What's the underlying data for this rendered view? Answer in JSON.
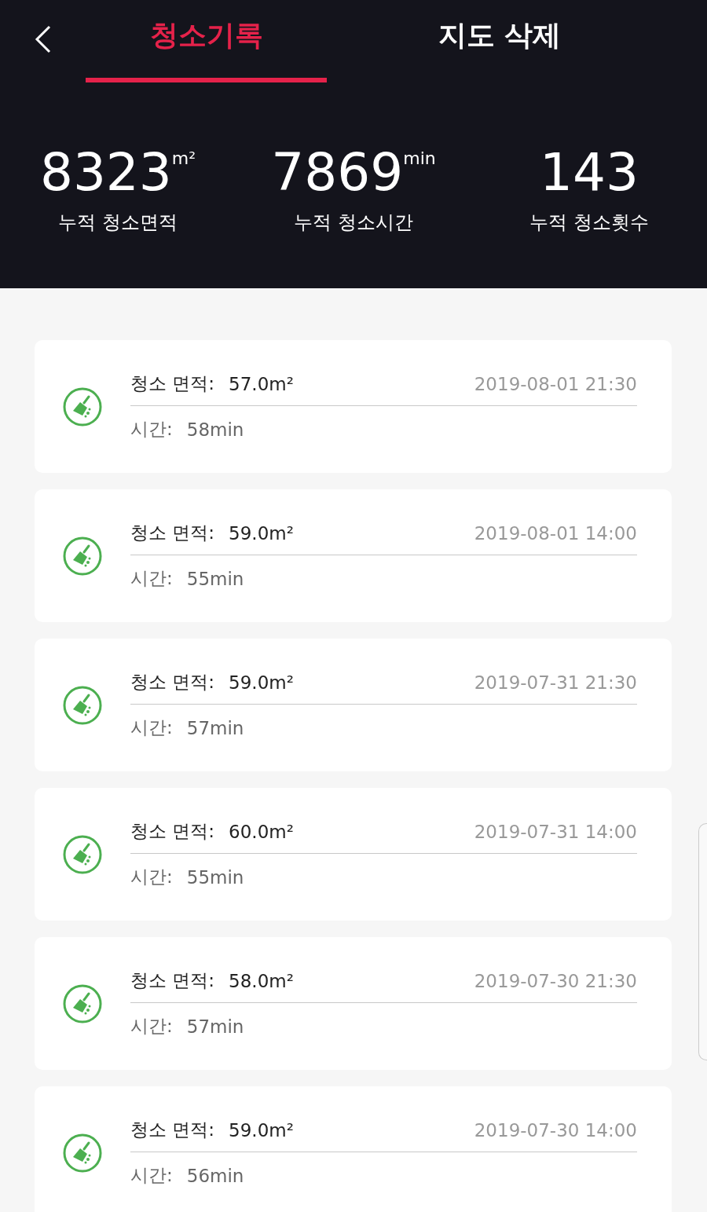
{
  "header": {
    "tabs": [
      {
        "label": "청소기록",
        "selected": true
      },
      {
        "label": "지도 삭제",
        "selected": false
      }
    ]
  },
  "stats": [
    {
      "value": "8323",
      "unit": "m²",
      "label": "누적 청소면적"
    },
    {
      "value": "7869",
      "unit": "min",
      "label": "누적 청소시간"
    },
    {
      "value": "143",
      "label": "누적 청소횟수"
    }
  ],
  "records": [
    {
      "area_label": "청소 면적:",
      "area": "57.0m²",
      "datetime": "2019-08-01 21:30",
      "time_label": "시간:",
      "time": "58min"
    },
    {
      "area_label": "청소 면적:",
      "area": "59.0m²",
      "datetime": "2019-08-01 14:00",
      "time_label": "시간:",
      "time": "55min"
    },
    {
      "area_label": "청소 면적:",
      "area": "59.0m²",
      "datetime": "2019-07-31 21:30",
      "time_label": "시간:",
      "time": "57min"
    },
    {
      "area_label": "청소 면적:",
      "area": "60.0m²",
      "datetime": "2019-07-31 14:00",
      "time_label": "시간:",
      "time": "55min"
    },
    {
      "area_label": "청소 면적:",
      "area": "58.0m²",
      "datetime": "2019-07-30 21:30",
      "time_label": "시간:",
      "time": "57min"
    },
    {
      "area_label": "청소 면적:",
      "area": "59.0m²",
      "datetime": "2019-07-30 14:00",
      "time_label": "시간:",
      "time": "56min"
    }
  ]
}
